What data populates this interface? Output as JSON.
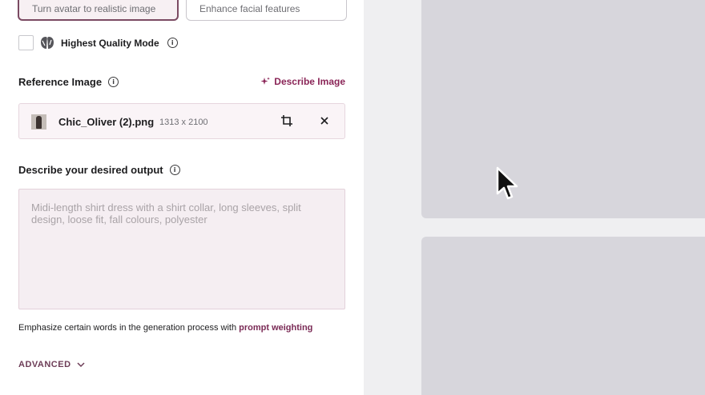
{
  "options": {
    "option_1": "Turn avatar to realistic image",
    "option_2": "Enhance facial features"
  },
  "quality": {
    "label": "Highest Quality Mode",
    "checked": false
  },
  "reference": {
    "title": "Reference Image",
    "describe_label": "Describe Image",
    "file_name": "Chic_Oliver (2).png",
    "file_dims": "1313 x 2100"
  },
  "output": {
    "title": "Describe your desired output",
    "placeholder": "Midi-length shirt dress with a shirt collar, long sleeves, split design, loose fit, fall colours, polyester"
  },
  "hint": {
    "text": "Emphasize certain words in the generation process with ",
    "link": "prompt weighting"
  },
  "advanced": {
    "label": "ADVANCED"
  },
  "colors": {
    "accent": "#8a2557",
    "selected_border": "#7b4a62",
    "placeholder_bg": "#d7d6dc"
  }
}
